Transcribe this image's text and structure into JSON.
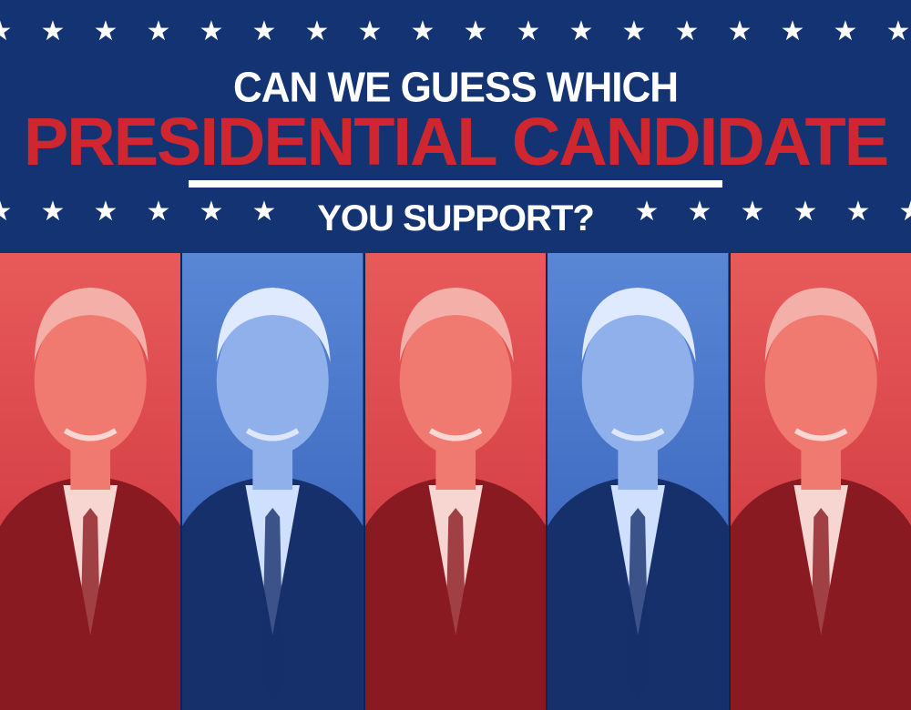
{
  "headline": {
    "line1": "CAN WE GUESS WHICH",
    "line2": "PRESIDENTIAL CANDIDATE",
    "line3": "YOU SUPPORT?"
  },
  "icons": {
    "star": "star-icon"
  },
  "colors": {
    "navy": "#143372",
    "red": "#d0262f",
    "white": "#ffffff",
    "red_tint": "#e44848",
    "blue_tint": "#3d6cc9"
  },
  "photos": [
    {
      "tint": "red"
    },
    {
      "tint": "blue"
    },
    {
      "tint": "red"
    },
    {
      "tint": "blue"
    },
    {
      "tint": "red"
    }
  ]
}
